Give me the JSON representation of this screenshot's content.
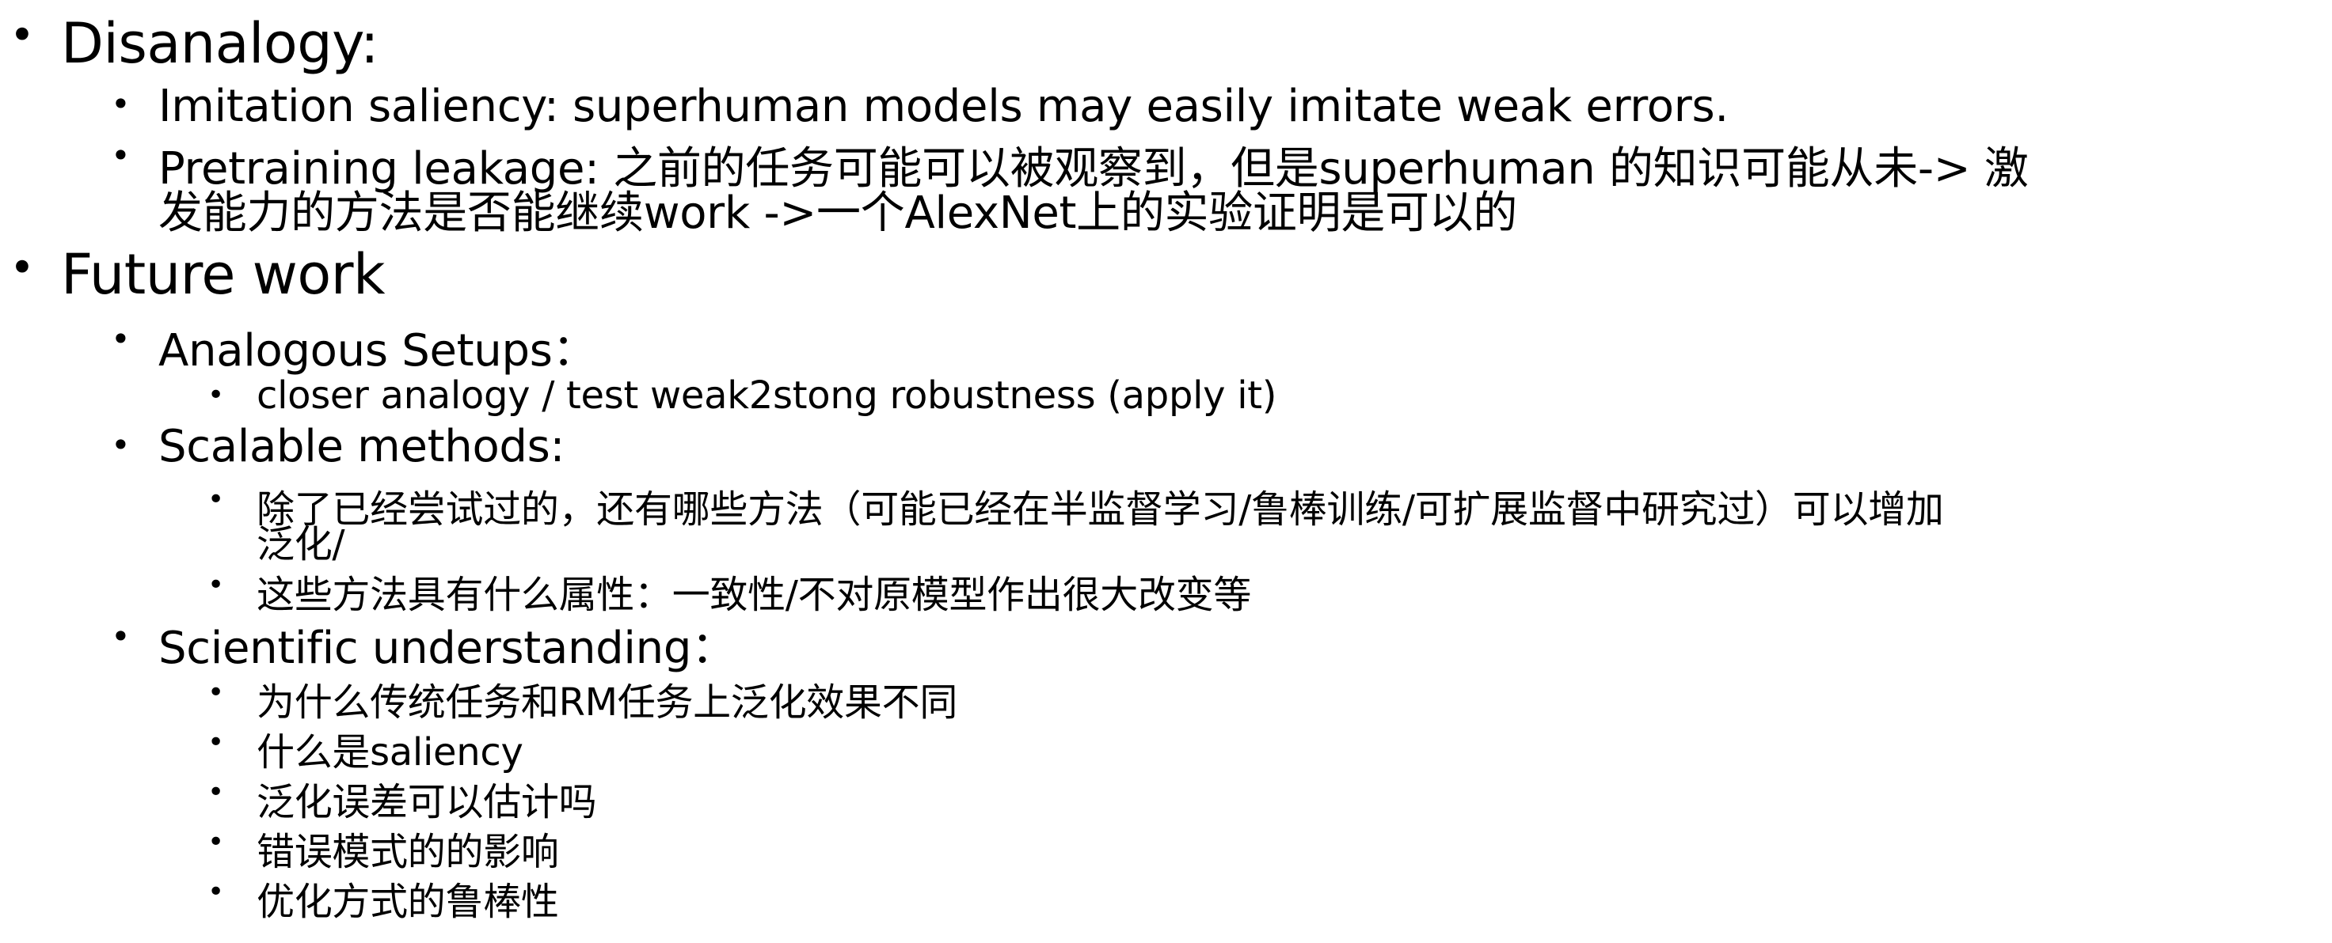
{
  "slide": {
    "bullet_char": "•",
    "sections": [
      {
        "heading": "Disanalogy:",
        "items": [
          {
            "text": "Imitation saliency: superhuman models may easily imitate weak errors."
          },
          {
            "line1": "Pretraining leakage: 之前的任务可能可以被观察到，但是superhuman 的知识可能从未-> 激",
            "line2": "发能力的方法是否能继续work ->一个AlexNet上的实验证明是可以的"
          }
        ]
      },
      {
        "heading": "Future work",
        "groups": [
          {
            "label": "Analogous Setups：",
            "subitems": [
              {
                "text": "closer analogy / test weak2stong robustness (apply it)"
              }
            ]
          },
          {
            "label": "Scalable methods:",
            "subitems": [
              {
                "line1": "除了已经尝试过的，还有哪些方法（可能已经在半监督学习/鲁棒训练/可扩展监督中研究过）可以增加",
                "line2": "泛化/"
              },
              {
                "text": "这些方法具有什么属性：一致性/不对原模型作出很大改变等"
              }
            ]
          },
          {
            "label": "Scientific understanding：",
            "subitems": [
              {
                "text": "为什么传统任务和RM任务上泛化效果不同"
              },
              {
                "text": "什么是saliency"
              },
              {
                "text": "泛化误差可以估计吗"
              },
              {
                "text": "错误模式的的影响"
              },
              {
                "text": "优化方式的鲁棒性"
              }
            ]
          }
        ]
      }
    ]
  }
}
